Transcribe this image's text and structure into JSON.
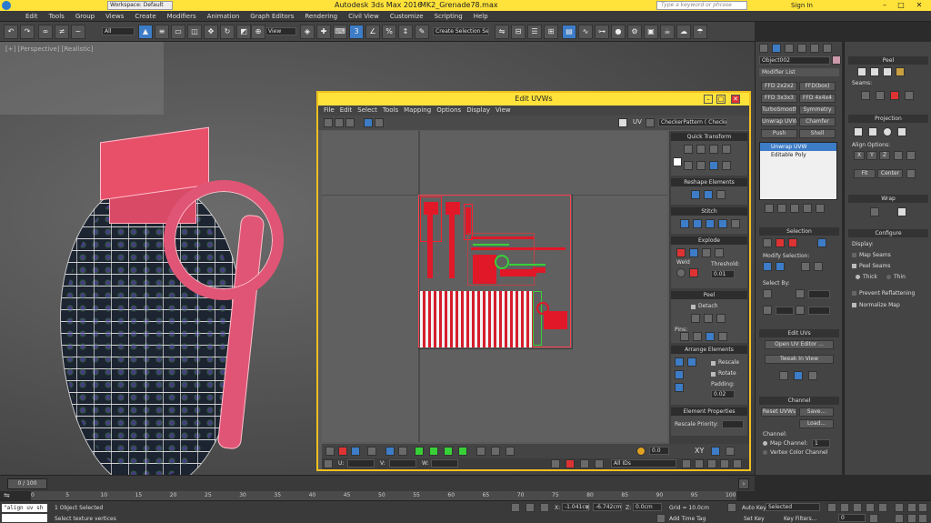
{
  "app": {
    "title": "Autodesk 3ds Max 2016",
    "file": "MK2_Grenade78.max",
    "workspace": "Workspace: Default",
    "search_placeholder": "Type a keyword or phrase",
    "sign_in": "Sign In"
  },
  "menu": [
    "Edit",
    "Tools",
    "Group",
    "Views",
    "Create",
    "Modifiers",
    "Animation",
    "Graph Editors",
    "Rendering",
    "Civil View",
    "Customize",
    "Scripting",
    "Help"
  ],
  "toolbar": {
    "selection_filter": "All",
    "ref_coord": "View",
    "named_selection": "Create Selection Se",
    "accent": "#3d7cc7"
  },
  "viewport": {
    "label": "[+] [Perspective] [Realistic]",
    "mesh_color": "#e05575",
    "timeline_position": "0 / 100"
  },
  "uv_editor": {
    "title": "Edit UVWs",
    "menu": [
      "File",
      "Edit",
      "Select",
      "Tools",
      "Mapping",
      "Options",
      "Display",
      "View"
    ],
    "uv_label": "UV",
    "checker": "CheckerPattern  ( Checker )",
    "quick_transform": "Quick Transform",
    "reshape": "Reshape Elements",
    "stitch": "Stitch",
    "explode": "Explode",
    "weld": "Weld",
    "threshold_label": "Threshold:",
    "threshold": "0.01",
    "peel": "Peel",
    "detach": "Detach",
    "pins": "Pins:",
    "arrange": "Arrange Elements",
    "rescale": "Rescale",
    "rotate": "Rotate",
    "padding_label": "Padding:",
    "padding": "0.02",
    "elem_props": "Element Properties",
    "rescale_priority": "Rescale Priority:",
    "bottom_value": "0.0",
    "xy": "XY",
    "u_label": "U:",
    "v_label": "V:",
    "w_label": "W:",
    "ids": "All IDs",
    "uv_color": "#e01828"
  },
  "command_panel": {
    "object_name": "Object002",
    "modifier_list": "Modifier List",
    "buttons": [
      "FFD 2x2x2",
      "FFD(box)",
      "FFD 3x3x3",
      "FFD 4x4x4",
      "TurboSmooth",
      "Symmetry",
      "Unwrap UVW",
      "Chamfer",
      "Push",
      "Shell"
    ],
    "stack": [
      "Unwrap UVW",
      "Editable Poly"
    ],
    "selection": "Selection",
    "modify_selection": "Modify Selection:",
    "select_by": "Select By:",
    "edit_uvs": "Edit UVs",
    "open_uv_editor": "Open UV Editor ...",
    "tweak_in_view": "Tweak In View",
    "channel": "Channel",
    "reset_uvws": "Reset UVWs",
    "save": "Save...",
    "load": "Load...",
    "channel_label": "Channel:",
    "map_channel": "Map Channel:",
    "map_channel_value": "1",
    "vertex_color_channel": "Vertex Color Channel"
  },
  "right_panel": {
    "peel": "Peel",
    "seams": "Seams:",
    "projection": "Projection",
    "align_options": "Align Options:",
    "align_x": "X",
    "align_y": "Y",
    "align_z": "Z",
    "fit": "Fit",
    "center": "Center",
    "wrap": "Wrap",
    "configure": "Configure",
    "display": "Display:",
    "map_seams": "Map Seams",
    "peel_seams": "Peel Seams",
    "thick": "Thick",
    "thin": "Thin",
    "prevent_reflattening": "Prevent Reflattening",
    "normalize_map": "Normalize Map"
  },
  "status": {
    "maxscript": "\"align uv sh",
    "objects_selected": "1 Object Selected",
    "prompt": "Select texture vertices",
    "x_label": "X:",
    "x": "-1.041cm",
    "y_label": "Y:",
    "y": "-6.742cm",
    "z_label": "Z:",
    "z": "0.0cm",
    "grid": "Grid = 10.0cm",
    "add_time_tag": "Add Time Tag",
    "auto_key": "Auto Key",
    "set_key": "Set Key",
    "selected": "Selected",
    "key_filters": "Key Filters...",
    "frame": "0",
    "ticks": [
      "0",
      "5",
      "10",
      "15",
      "20",
      "25",
      "30",
      "35",
      "40",
      "45",
      "50",
      "55",
      "60",
      "65",
      "70",
      "75",
      "80",
      "85",
      "90",
      "95",
      "100"
    ]
  }
}
